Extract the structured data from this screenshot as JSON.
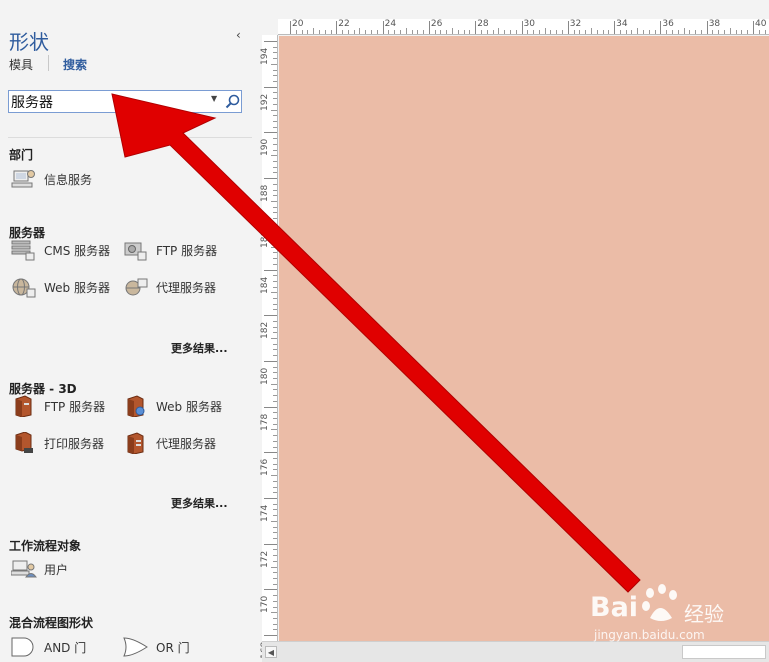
{
  "pane": {
    "title": "形状",
    "collapse_glyph": "‹",
    "tabs": {
      "stencils": "模具",
      "search": "搜索"
    },
    "search": {
      "value": "服务器",
      "placeholder": ""
    }
  },
  "categories": [
    {
      "name": "部门",
      "items": [
        {
          "label": "信息服务",
          "icon": "information-service-icon"
        }
      ]
    },
    {
      "name": "服务器",
      "items": [
        {
          "label": "CMS 服务器",
          "icon": "cms-server-icon"
        },
        {
          "label": "FTP 服务器",
          "icon": "ftp-server-icon"
        },
        {
          "label": "Web 服务器",
          "icon": "web-server-icon"
        },
        {
          "label": "代理服务器",
          "icon": "proxy-server-icon"
        }
      ],
      "more": "更多结果..."
    },
    {
      "name": "服务器 - 3D",
      "items": [
        {
          "label": "FTP 服务器",
          "icon": "ftp-server-3d-icon"
        },
        {
          "label": "Web 服务器",
          "icon": "web-server-3d-icon"
        },
        {
          "label": "打印服务器",
          "icon": "print-server-3d-icon"
        },
        {
          "label": "代理服务器",
          "icon": "proxy-server-3d-icon"
        }
      ],
      "more": "更多结果..."
    },
    {
      "name": "工作流程对象",
      "items": [
        {
          "label": "用户",
          "icon": "user-icon"
        }
      ]
    },
    {
      "name": "混合流程图形状",
      "items": [
        {
          "label": "AND 门",
          "icon": "and-gate-icon"
        },
        {
          "label": "OR 门",
          "icon": "or-gate-icon"
        }
      ]
    }
  ],
  "rulers": {
    "top": [
      "20",
      "22",
      "24",
      "26",
      "28",
      "30",
      "32",
      "34",
      "36",
      "38",
      "40"
    ],
    "left": [
      "194",
      "192",
      "190",
      "188",
      "186",
      "184",
      "182",
      "180",
      "178",
      "176",
      "174",
      "172",
      "170",
      "168"
    ]
  },
  "colors": {
    "canvas": "#ebbca7",
    "accent": "#2f5c9e",
    "arrow": "#e00000"
  },
  "watermark": {
    "brand": "Bai",
    "brand_cn": "经验",
    "site": "jingyan.baidu.com"
  }
}
